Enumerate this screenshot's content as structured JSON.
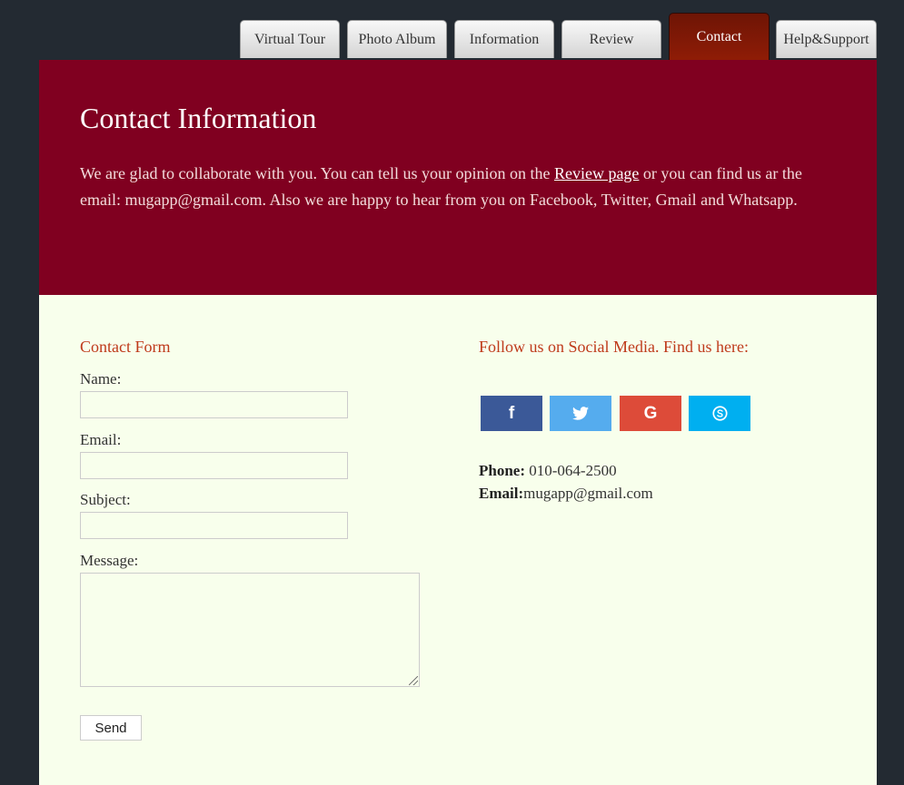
{
  "tabs": [
    {
      "label": "Virtual Tour"
    },
    {
      "label": "Photo Album"
    },
    {
      "label": "Information"
    },
    {
      "label": "Review"
    },
    {
      "label": "Contact"
    },
    {
      "label": "Help&Support"
    }
  ],
  "active_tab": "Contact",
  "hero": {
    "title": "Contact Information",
    "text_before_link": "We are glad to collaborate with you. You can tell us your opinion on the ",
    "link_label": "Review page",
    "text_after_link": " or you can find us ar the email: mugapp@gmail.com. Also we are happy to hear from you on Facebook, Twitter, Gmail and Whatsapp."
  },
  "form": {
    "title": "Contact Form",
    "name_label": "Name:",
    "name_value": "",
    "email_label": "Email:",
    "email_value": "",
    "subject_label": "Subject:",
    "subject_value": "",
    "message_label": "Message:",
    "message_value": "",
    "send_label": "Send"
  },
  "social": {
    "title": "Follow us on Social Media. Find us here:",
    "buttons": [
      {
        "name": "facebook-icon",
        "glyph": "f",
        "color": "#3b5998"
      },
      {
        "name": "twitter-icon",
        "glyph": "t",
        "color": "#55acee"
      },
      {
        "name": "google-icon",
        "glyph": "G",
        "color": "#dd4b39"
      },
      {
        "name": "skype-icon",
        "glyph": "S",
        "color": "#00aff0"
      }
    ]
  },
  "contact": {
    "phone_label": "Phone:",
    "phone_value": " 010-064-2500",
    "email_label": "Email:",
    "email_value": "mugapp@gmail.com"
  },
  "colors": {
    "page_bg": "#232a32",
    "hero_bg": "#800020",
    "panel_bg": "#f8ffec",
    "accent_title": "#bf3a1b",
    "active_tab": "#8f1c06"
  }
}
